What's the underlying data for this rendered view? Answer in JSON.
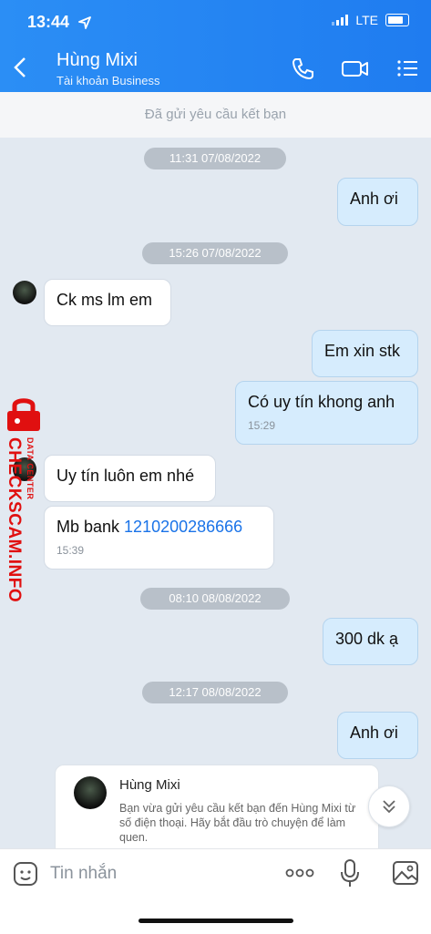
{
  "status_bar": {
    "time": "13:44",
    "network": "LTE"
  },
  "header": {
    "contact_name": "Hùng Mixi",
    "account_type": "Tài khoản Business"
  },
  "friend_request_banner": "Đã gửi yêu cầu kết bạn",
  "messages": {
    "date1": "11:31 07/08/2022",
    "m1": "Anh ơi",
    "date2": "15:26 07/08/2022",
    "m2": "Ck ms lm em",
    "m3": "Em xin stk",
    "m4": "Có uy tín khong anh",
    "m4_time": "15:29",
    "m5": "Uy tín luôn em nhé",
    "m6_prefix": "Mb bank ",
    "m6_link": "1210200286666",
    "m6_time": "15:39",
    "date3": "08:10 08/08/2022",
    "m7": "300 dk ạ",
    "date4": "12:17 08/08/2022",
    "m8": "Anh ơi"
  },
  "friend_card": {
    "name": "Hùng Mixi",
    "body": "Bạn vừa gửi yêu cầu kết bạn đến Hùng Mixi từ số điện thoại. Hãy bắt đầu trò chuyện để làm quen."
  },
  "input": {
    "placeholder": "Tin nhắn"
  },
  "watermark": {
    "main": "CHECKSCAM.INFO",
    "sub": "DATA CENTER"
  },
  "colors": {
    "header": "#2285f3",
    "link": "#1a73e8",
    "my_bubble": "#d6ecfd",
    "watermark": "#e01010"
  }
}
